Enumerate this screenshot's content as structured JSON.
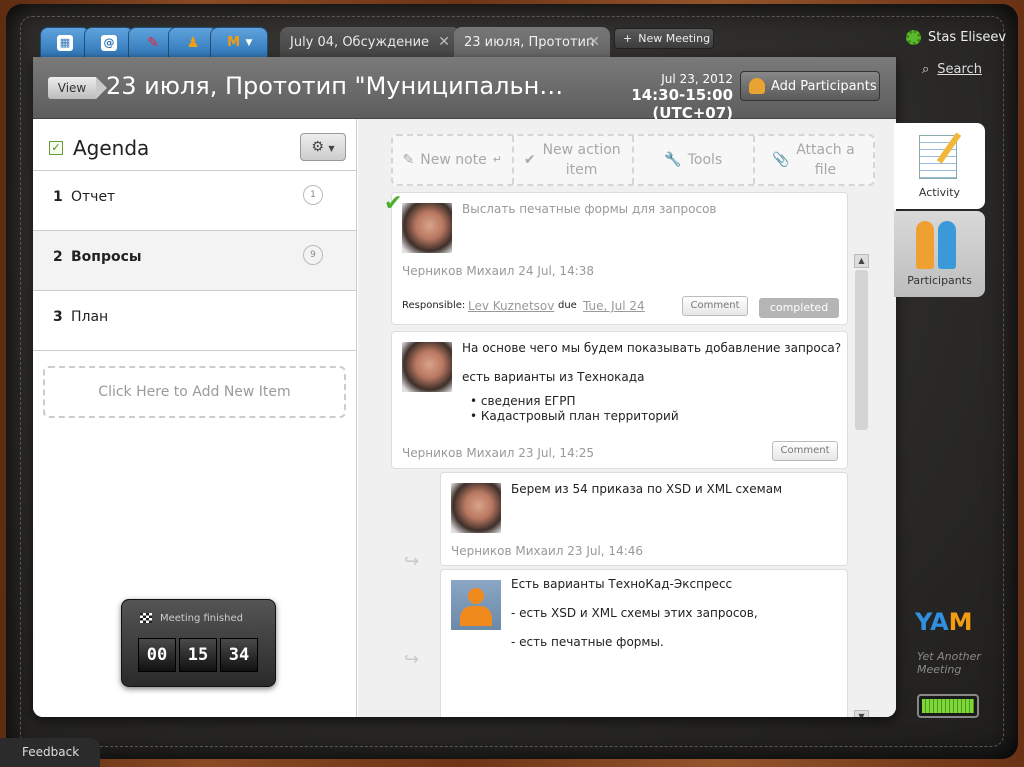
{
  "tabs": {
    "apps": [
      "calendar-icon",
      "mail-icon",
      "brush-icon",
      "people-icon",
      "yam-menu-icon"
    ],
    "meeting_tabs": [
      {
        "label": "July 04, Обсуждение"
      },
      {
        "label": "23 июля, Прототип"
      }
    ],
    "new_meeting_label": "New Meeting"
  },
  "user": {
    "name": "Stas Eliseev",
    "search_label": "Search"
  },
  "header": {
    "view_label": "View",
    "title": "23 июля, Прототип \"Муниципальные...",
    "date": "Jul 23, 2012",
    "time": "14:30-15:00 (UTC+07)",
    "add_participants_label": "Add Participants"
  },
  "agenda": {
    "title": "Agenda",
    "items": [
      {
        "num": "1",
        "label": "Отчет",
        "count": "1"
      },
      {
        "num": "2",
        "label": "Вопросы",
        "count": "9"
      },
      {
        "num": "3",
        "label": "План",
        "count": ""
      }
    ],
    "add_item_label": "Click Here to Add New Item"
  },
  "timer": {
    "label": "Meeting finished",
    "hh": "00",
    "mm": "15",
    "ss": "34"
  },
  "toolbar": {
    "new_note": "New note",
    "new_action_item": "New action item",
    "tools": "Tools",
    "attach_file": "Attach a file"
  },
  "feed": [
    {
      "text": "Выслать печатные формы для запросов",
      "meta": "Черников Михаил 24 Jul, 14:38",
      "responsible_label": "Responsible:",
      "responsible": "Lev Kuznetsov",
      "due_label": "due",
      "due": "Tue, Jul 24",
      "comment_label": "Comment",
      "status": "completed"
    },
    {
      "text": "На основе чего мы будем показывать добавление запроса?",
      "text2": "есть варианты из Технокада",
      "bullets": [
        "сведения ЕГРП",
        "Кадастровый план территорий"
      ],
      "meta": "Черников Михаил 23 Jul, 14:25",
      "comment_label": "Comment"
    },
    {
      "text": "Берем из 54 приказа по XSD и XML схемам",
      "meta": "Черников Михаил 23 Jul, 14:46"
    },
    {
      "text": "Есть варианты ТехноКад-Экспресс",
      "text2": "- есть XSD и XML схемы этих запросов,",
      "text3": "- есть печатные формы."
    }
  ],
  "side_tabs": {
    "activity": "Activity",
    "participants": "Participants"
  },
  "logo": {
    "brand": "YA",
    "brand_m": "M",
    "tagline1": "Yet Another",
    "tagline2": "Meeting"
  },
  "battery_level": 1.0,
  "feedback_label": "Feedback"
}
